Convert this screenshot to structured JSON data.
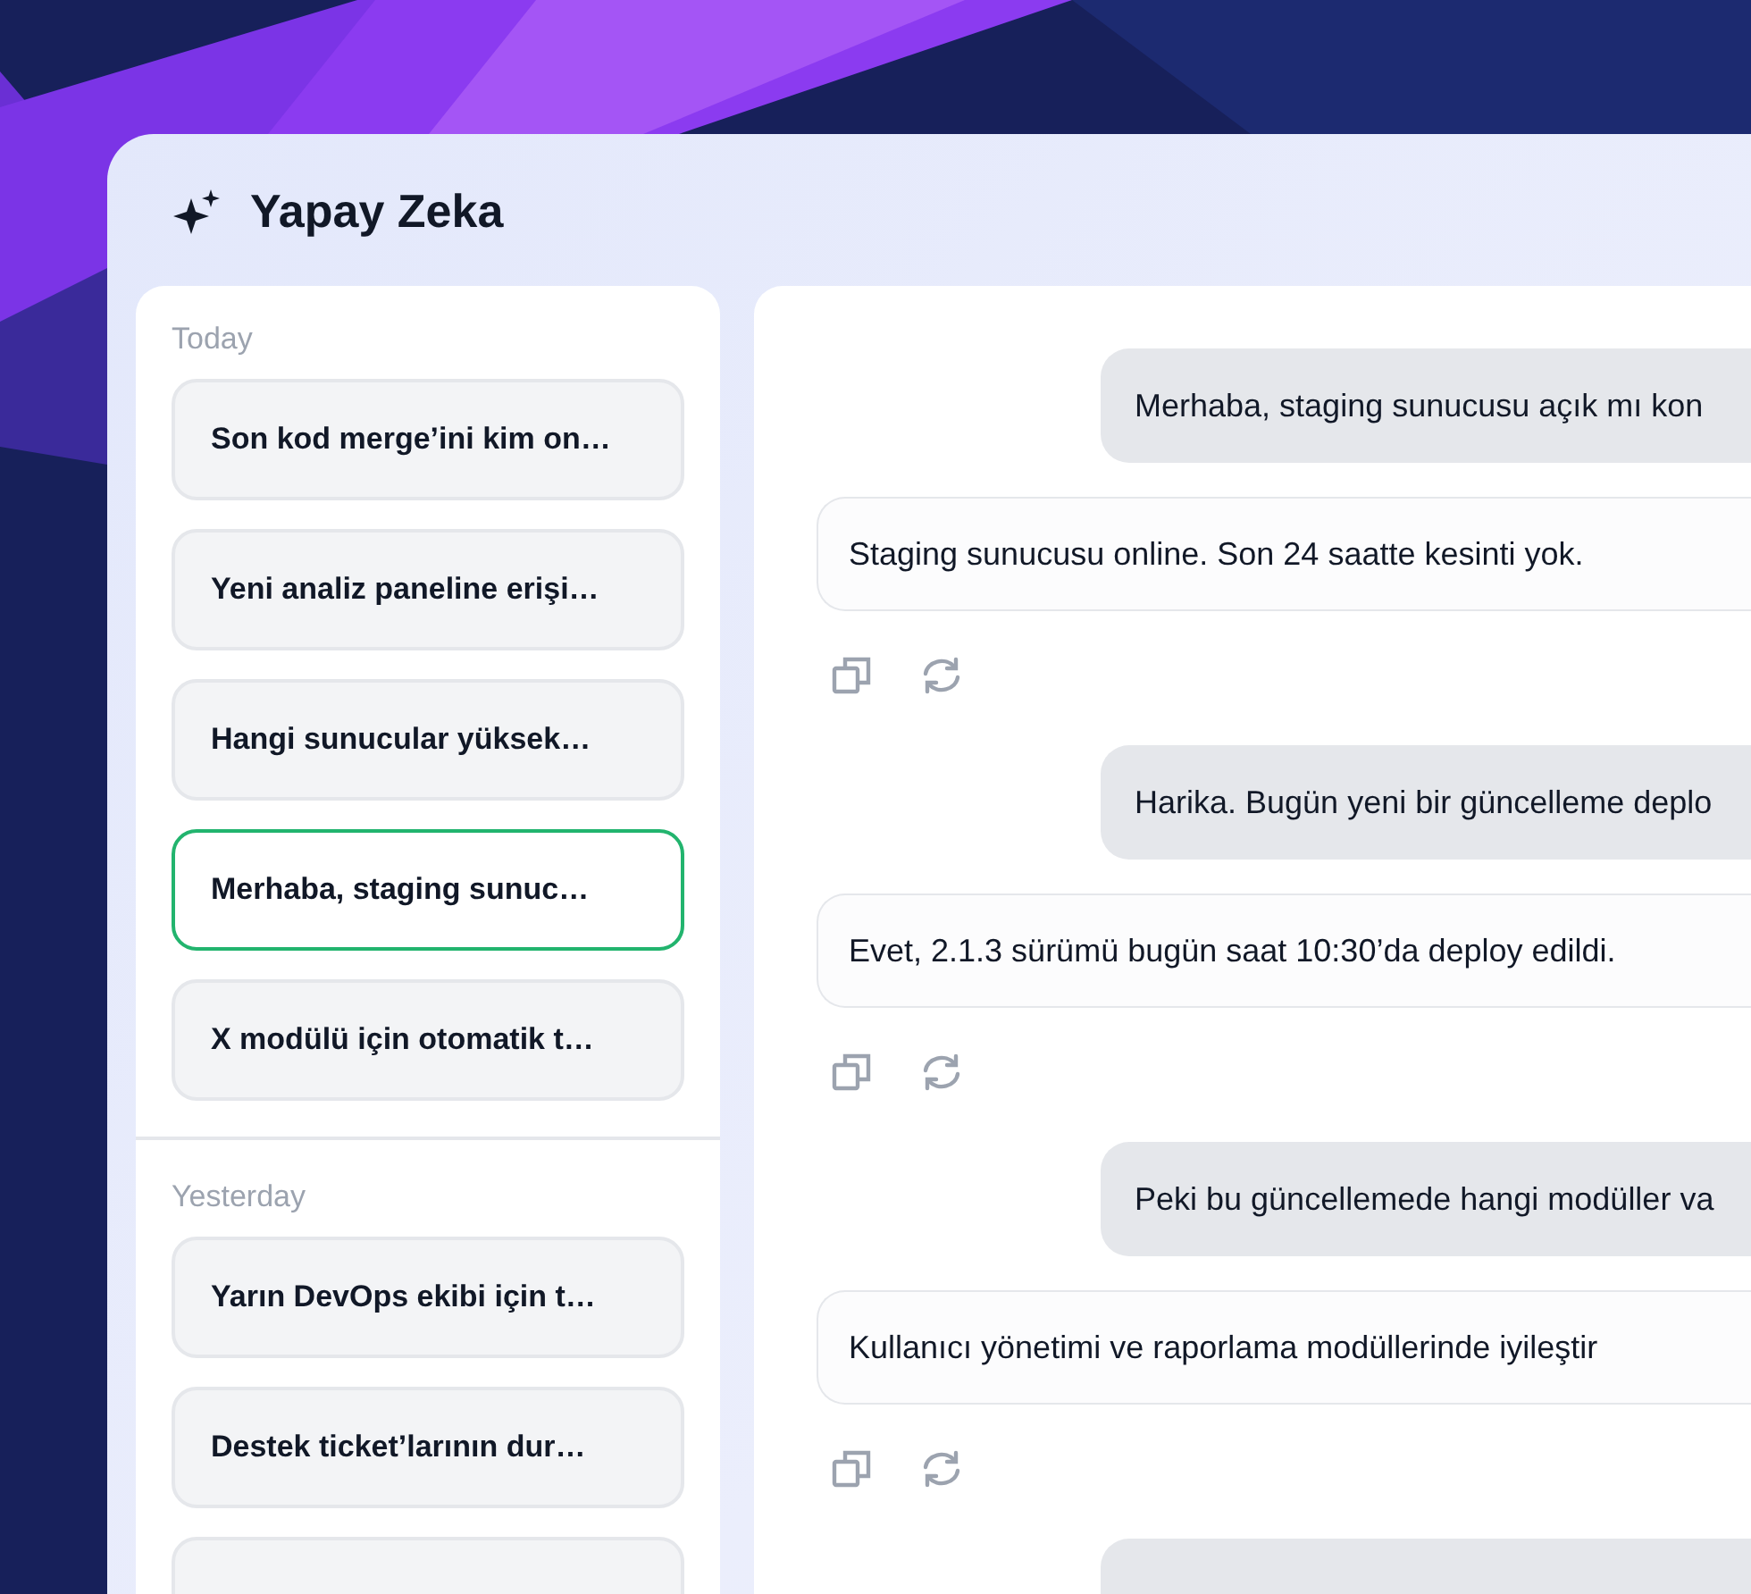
{
  "app": {
    "title": "Yapay Zeka"
  },
  "sidebar": {
    "groups": [
      {
        "label": "Today",
        "items": [
          {
            "label": "Son kod merge’ini kim on…",
            "selected": false
          },
          {
            "label": "Yeni analiz paneline erişi…",
            "selected": false
          },
          {
            "label": "Hangi sunucular yüksek…",
            "selected": false
          },
          {
            "label": "Merhaba, staging sunuc…",
            "selected": true
          },
          {
            "label": "X modülü için otomatik t…",
            "selected": false
          }
        ]
      },
      {
        "label": "Yesterday",
        "items": [
          {
            "label": "Yarın DevOps ekibi için t…",
            "selected": false
          },
          {
            "label": "Destek ticket’larının dur…",
            "selected": false
          },
          {
            "selected": false
          }
        ]
      }
    ]
  },
  "chat": {
    "messages": [
      {
        "kind": "user",
        "text": "Merhaba, staging sunucusu açık mı kon"
      },
      {
        "kind": "assistant",
        "text": "Staging sunucusu online. Son 24 saatte kesinti yok."
      },
      {
        "kind": "user",
        "text": "Harika. Bugün yeni bir güncelleme deplo"
      },
      {
        "kind": "assistant",
        "text": "Evet, 2.1.3 sürümü bugün saat 10:30’da deploy edildi."
      },
      {
        "kind": "user",
        "text": "Peki bu güncellemede hangi modüller va"
      },
      {
        "kind": "assistant",
        "text": "Kullanıcı yönetimi ve raporlama modüllerinde iyileştir"
      },
      {
        "kind": "user"
      }
    ]
  }
}
